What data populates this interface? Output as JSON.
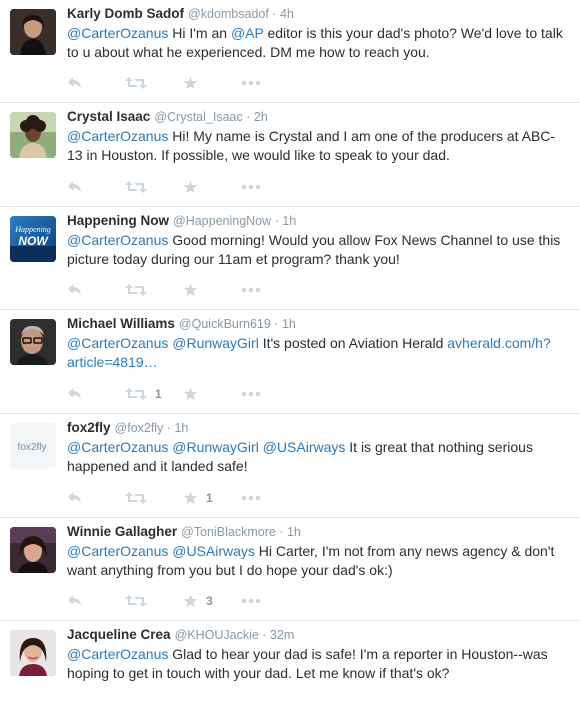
{
  "icons": {
    "reply": "reply-icon",
    "retweet": "retweet-icon",
    "favorite": "favorite-icon",
    "more": "more-icon"
  },
  "colors": {
    "link": "#2b7bb9",
    "muted": "#8899a6",
    "icon": "#ccd6dd",
    "divider": "#e1e8ed"
  },
  "tweets": [
    {
      "fullname": "Karly Domb Sadof",
      "username": "@kdombsadof",
      "time": "4h",
      "parts": [
        {
          "t": "@CarterOzanus",
          "k": "mention"
        },
        {
          "t": " Hi I'm an ",
          "k": "text"
        },
        {
          "t": "@AP",
          "k": "mention"
        },
        {
          "t": " editor is this your dad's photo? We'd love to talk to u about what he experienced. DM me how to reach you.",
          "k": "text"
        }
      ],
      "retweets": "",
      "favorites": ""
    },
    {
      "fullname": "Crystal Isaac",
      "username": "@Crystal_Isaac",
      "time": "2h",
      "parts": [
        {
          "t": "@CarterOzanus",
          "k": "mention"
        },
        {
          "t": " Hi! My name is Crystal and I am one of the producers at ABC-13 in Houston. If possible, we would like to speak to your dad.",
          "k": "text"
        }
      ],
      "retweets": "",
      "favorites": ""
    },
    {
      "fullname": "Happening Now",
      "username": "@HappeningNow",
      "time": "1h",
      "parts": [
        {
          "t": "@CarterOzanus",
          "k": "mention"
        },
        {
          "t": " Good morning! Would you allow Fox News Channel to use this picture today during our 11am et program? thank you!",
          "k": "text"
        }
      ],
      "retweets": "",
      "favorites": ""
    },
    {
      "fullname": "Michael Williams",
      "username": "@QuickBurn619",
      "time": "1h",
      "parts": [
        {
          "t": "@CarterOzanus",
          "k": "mention"
        },
        {
          "t": " ",
          "k": "text"
        },
        {
          "t": "@RunwayGirl",
          "k": "mention"
        },
        {
          "t": " It's posted on Aviation Herald ",
          "k": "text"
        },
        {
          "t": "avherald.com/h?article=4819…",
          "k": "link"
        }
      ],
      "retweets": "1",
      "favorites": ""
    },
    {
      "fullname": "fox2fly",
      "username": "@fox2fly",
      "time": "1h",
      "parts": [
        {
          "t": "@CarterOzanus",
          "k": "mention"
        },
        {
          "t": " ",
          "k": "text"
        },
        {
          "t": "@RunwayGirl",
          "k": "mention"
        },
        {
          "t": " ",
          "k": "text"
        },
        {
          "t": "@USAirways",
          "k": "mention"
        },
        {
          "t": " It is great that nothing serious happened and it landed safe!",
          "k": "text"
        }
      ],
      "retweets": "",
      "favorites": "1"
    },
    {
      "fullname": "Winnie Gallagher",
      "username": "@ToniBlackmore",
      "time": "1h",
      "parts": [
        {
          "t": "@CarterOzanus",
          "k": "mention"
        },
        {
          "t": " ",
          "k": "text"
        },
        {
          "t": "@USAirways",
          "k": "mention"
        },
        {
          "t": " Hi Carter, I'm not from any news agency & don't want anything from you but I do hope your dad's ok:)",
          "k": "text"
        }
      ],
      "retweets": "",
      "favorites": "3"
    },
    {
      "fullname": "Jacqueline Crea",
      "username": "@KHOUJackie",
      "time": "32m",
      "parts": [
        {
          "t": "@CarterOzanus",
          "k": "mention"
        },
        {
          "t": " Glad to hear your dad is safe! I'm a reporter in Houston--was hoping to get in touch with your dad. Let me know if that's ok?",
          "k": "text"
        }
      ],
      "retweets": "",
      "favorites": ""
    }
  ],
  "avatar_text": {
    "happening": "Happening",
    "now": "NOW",
    "fox2fly": "fox2fly"
  }
}
